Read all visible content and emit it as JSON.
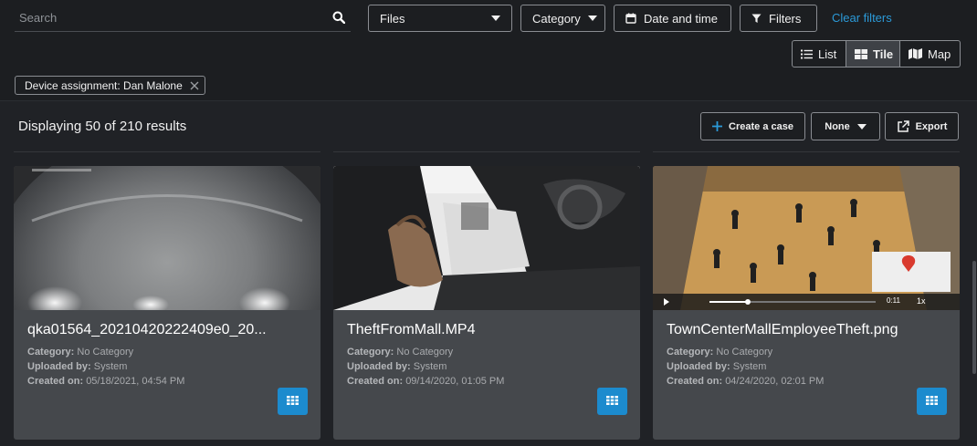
{
  "search": {
    "placeholder": "Search"
  },
  "filters": {
    "files_label": "Files",
    "category_label": "Category",
    "date_label": "Date and time",
    "filters_label": "Filters",
    "clear_label": "Clear filters"
  },
  "views": {
    "list": "List",
    "tile": "Tile",
    "map": "Map",
    "active": "Tile"
  },
  "chip": {
    "label": "Device assignment: Dan Malone"
  },
  "results": {
    "count_text": "Displaying 50 of 210 results",
    "create_case": "Create a case",
    "sort_value": "None",
    "export": "Export"
  },
  "cards": [
    {
      "title": "qka01564_20210420222409e0_20...",
      "category_label": "Category:",
      "category": "No Category",
      "uploaded_label": "Uploaded by:",
      "uploaded": "System",
      "created_label": "Created on:",
      "created": "05/18/2021, 04:54 PM"
    },
    {
      "title": "TheftFromMall.MP4",
      "category_label": "Category:",
      "category": "No Category",
      "uploaded_label": "Uploaded by:",
      "uploaded": "System",
      "created_label": "Created on:",
      "created": "09/14/2020, 01:05 PM"
    },
    {
      "title": "TownCenterMallEmployeeTheft.png",
      "category_label": "Category:",
      "category": "No Category",
      "uploaded_label": "Uploaded by:",
      "uploaded": "System",
      "created_label": "Created on:",
      "created": "04/24/2020, 02:01 PM",
      "player": {
        "time": "0:11",
        "speed": "1x"
      }
    }
  ],
  "colors": {
    "accent": "#1c8bce",
    "link": "#2b9ad8",
    "background": "#1c1e21",
    "card": "#45484c"
  }
}
